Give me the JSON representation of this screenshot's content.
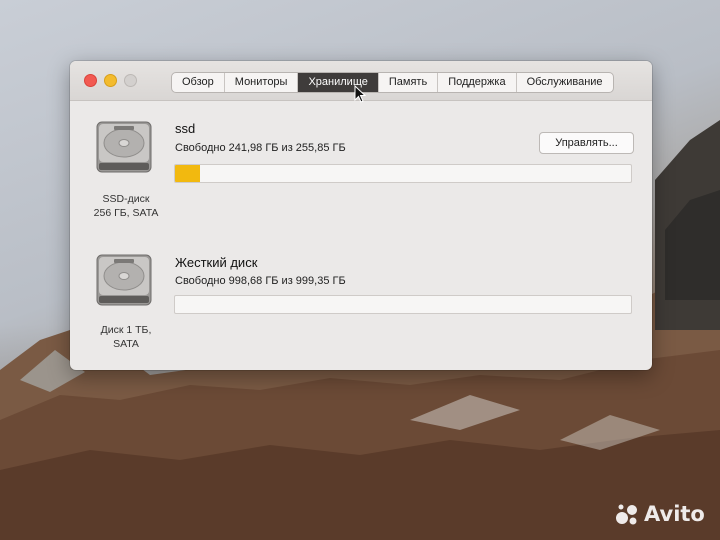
{
  "window": {
    "tabs": [
      {
        "label": "Обзор"
      },
      {
        "label": "Мониторы"
      },
      {
        "label": "Хранилище",
        "active": true
      },
      {
        "label": "Память"
      },
      {
        "label": "Поддержка"
      },
      {
        "label": "Обслуживание"
      }
    ],
    "manage_button_label": "Управлять..."
  },
  "disks": [
    {
      "name": "ssd",
      "free_text": "Свободно 241,98 ГБ из 255,85 ГБ",
      "caption_line1": "SSD-диск",
      "caption_line2": "256 ГБ, SATA",
      "used_fraction": 0.054,
      "fill_color": "#f2b90f",
      "icon": "hard-drive-icon"
    },
    {
      "name": "Жесткий диск",
      "free_text": "Свободно 998,68 ГБ из 999,35 ГБ",
      "caption_line1": "Диск 1 ТБ,",
      "caption_line2": "SATA",
      "used_fraction": 0.001,
      "fill_color": "#f2b90f",
      "icon": "hard-drive-icon"
    }
  ],
  "watermark": {
    "text": "Avito",
    "icon": "avito-logo-icon"
  },
  "colors": {
    "close": "#f25a52",
    "minimize": "#f3bb2e",
    "zoom_inactive": "#d3d0ce",
    "active_tab": "#3f3c3b"
  }
}
